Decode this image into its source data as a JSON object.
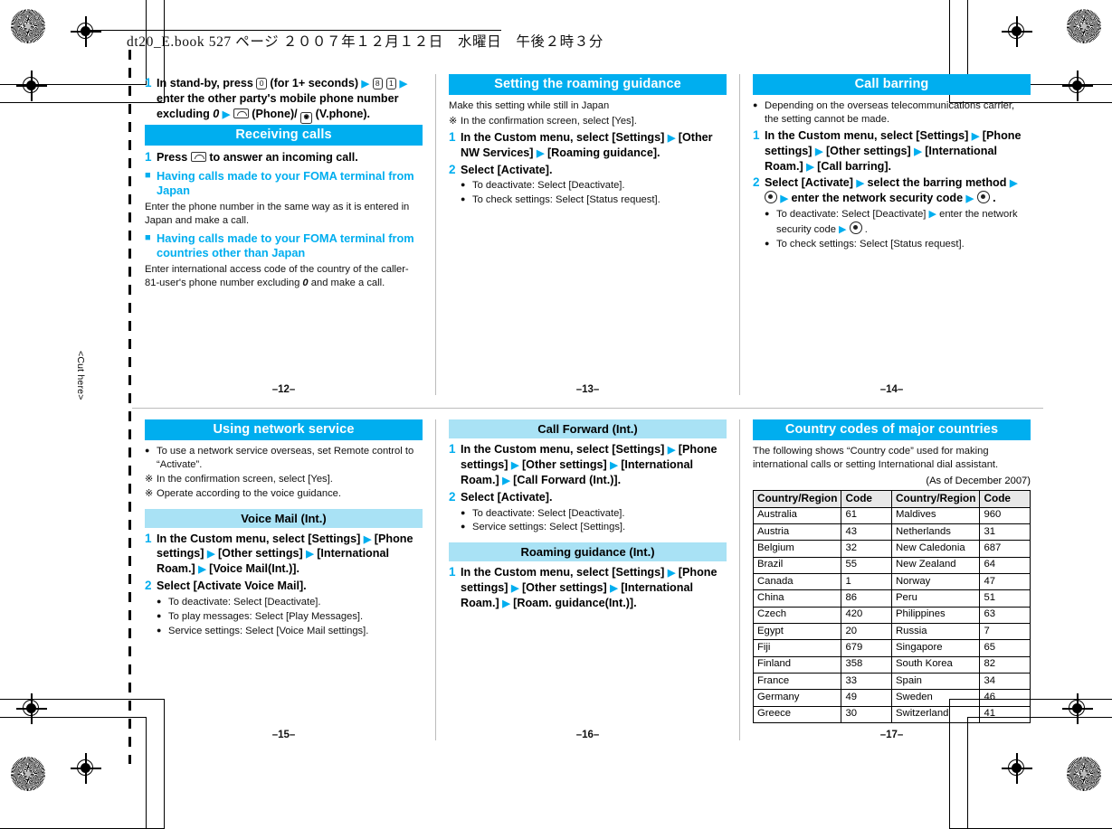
{
  "book_header": "dt20_E.book   527 ページ   ２００７年１２月１２日　水曜日　午後２時３分",
  "cut_here_label": "<Cut here>",
  "colors": {
    "accent": "#00aeef",
    "subhead": "#a9e2f5",
    "table_header": "#e8e8e8"
  },
  "pages": [
    {
      "page_number": "–12–",
      "blocks": [
        {
          "type": "step",
          "num": "1",
          "parts": [
            {
              "t": "text",
              "v": "In stand-by, press "
            },
            {
              "t": "key",
              "v": "0"
            },
            {
              "t": "text",
              "v": " (for 1+ seconds)"
            },
            {
              "t": "arrow"
            },
            {
              "t": "key",
              "v": "8"
            },
            {
              "t": "key",
              "v": "1"
            },
            {
              "t": "arrow"
            },
            {
              "t": "text",
              "v": " enter the other party's mobile phone number excluding "
            },
            {
              "t": "ital",
              "v": "0"
            },
            {
              "t": "arrow"
            },
            {
              "t": "key-call"
            },
            {
              "t": "text",
              "v": " (Phone)/"
            },
            {
              "t": "key-vph"
            },
            {
              "t": "text",
              "v": " (V.phone)."
            }
          ]
        },
        {
          "type": "sec-head",
          "v": "Receiving calls"
        },
        {
          "type": "step",
          "num": "1",
          "parts": [
            {
              "t": "text",
              "v": "Press "
            },
            {
              "t": "key-call"
            },
            {
              "t": "text",
              "v": " to answer an incoming call."
            }
          ]
        },
        {
          "type": "blue-head",
          "v": "Having calls made to your FOMA terminal from Japan"
        },
        {
          "type": "plain",
          "v": "Enter the phone number in the same way as it is entered in Japan and make a call."
        },
        {
          "type": "blue-head",
          "v": "Having calls made to your FOMA terminal from countries other than Japan"
        },
        {
          "type": "plain-ital0",
          "pre": "Enter international access code of the country of the caller-81-user's phone number excluding ",
          "ital": "0",
          "post": " and make a call."
        }
      ]
    },
    {
      "page_number": "–13–",
      "blocks": [
        {
          "type": "sec-head",
          "v": "Setting the roaming guidance"
        },
        {
          "type": "plain",
          "v": "Make this setting while still in Japan"
        },
        {
          "type": "note",
          "mark": "※",
          "v": "In the confirmation screen, select [Yes]."
        },
        {
          "type": "step",
          "num": "1",
          "parts": [
            {
              "t": "text",
              "v": "In the Custom menu, select [Settings]"
            },
            {
              "t": "arrow"
            },
            {
              "t": "text",
              "v": " [Other NW Services]"
            },
            {
              "t": "arrow"
            },
            {
              "t": "text",
              "v": " [Roaming guidance]."
            }
          ]
        },
        {
          "type": "step",
          "num": "2",
          "parts": [
            {
              "t": "text",
              "v": "Select [Activate]."
            }
          ]
        },
        {
          "type": "bullets",
          "items": [
            "To deactivate: Select [Deactivate].",
            "To check settings: Select [Status request]."
          ]
        }
      ]
    },
    {
      "page_number": "–14–",
      "blocks": [
        {
          "type": "sec-head",
          "v": "Call barring"
        },
        {
          "type": "note",
          "mark": "●",
          "v": "Depending on the overseas telecommunications carrier, the setting cannot be made."
        },
        {
          "type": "step",
          "num": "1",
          "parts": [
            {
              "t": "text",
              "v": "In the Custom menu, select [Settings]"
            },
            {
              "t": "arrow"
            },
            {
              "t": "text",
              "v": " [Phone settings]"
            },
            {
              "t": "arrow"
            },
            {
              "t": "text",
              "v": " [Other settings]"
            },
            {
              "t": "arrow"
            },
            {
              "t": "text",
              "v": " [International Roam.]"
            },
            {
              "t": "arrow"
            },
            {
              "t": "text",
              "v": " [Call barring]."
            }
          ]
        },
        {
          "type": "step",
          "num": "2",
          "parts": [
            {
              "t": "text",
              "v": "Select [Activate]"
            },
            {
              "t": "arrow"
            },
            {
              "t": "text",
              "v": " select the barring method"
            },
            {
              "t": "arrow"
            },
            {
              "t": "key-sel"
            },
            {
              "t": "arrow"
            },
            {
              "t": "text",
              "v": " enter the network security code"
            },
            {
              "t": "arrow"
            },
            {
              "t": "key-sel"
            },
            {
              "t": "text",
              "v": "."
            }
          ]
        },
        {
          "type": "bullets-rich",
          "items": [
            [
              {
                "t": "text",
                "v": "To deactivate: Select [Deactivate]"
              },
              {
                "t": "arrow"
              },
              {
                "t": "text",
                "v": " enter the network security code"
              },
              {
                "t": "arrow"
              },
              {
                "t": "key-sel"
              },
              {
                "t": "text",
                "v": "."
              }
            ],
            [
              {
                "t": "text",
                "v": "To check settings: Select [Status request]."
              }
            ]
          ]
        }
      ]
    },
    {
      "page_number": "–15–",
      "blocks": [
        {
          "type": "sec-head",
          "v": "Using network service"
        },
        {
          "type": "note",
          "mark": "●",
          "v": "To use a network service overseas, set Remote control to “Activate”."
        },
        {
          "type": "note",
          "mark": "※",
          "v": "In the confirmation screen, select [Yes]."
        },
        {
          "type": "note",
          "mark": "※",
          "v": "Operate according to the voice guidance."
        },
        {
          "type": "sub-head",
          "v": "Voice Mail (Int.)"
        },
        {
          "type": "step",
          "num": "1",
          "parts": [
            {
              "t": "text",
              "v": "In the Custom menu, select [Settings]"
            },
            {
              "t": "arrow"
            },
            {
              "t": "text",
              "v": " [Phone settings]"
            },
            {
              "t": "arrow"
            },
            {
              "t": "text",
              "v": " [Other settings]"
            },
            {
              "t": "arrow"
            },
            {
              "t": "text",
              "v": " [International Roam.]"
            },
            {
              "t": "arrow"
            },
            {
              "t": "text",
              "v": " [Voice Mail(Int.)]."
            }
          ]
        },
        {
          "type": "step",
          "num": "2",
          "parts": [
            {
              "t": "text",
              "v": "Select [Activate Voice Mail]."
            }
          ]
        },
        {
          "type": "bullets",
          "items": [
            "To deactivate: Select [Deactivate].",
            "To play messages: Select [Play Messages].",
            "Service settings: Select [Voice Mail settings]."
          ]
        }
      ]
    },
    {
      "page_number": "–16–",
      "blocks": [
        {
          "type": "sub-head-first",
          "v": "Call Forward (Int.)"
        },
        {
          "type": "step",
          "num": "1",
          "parts": [
            {
              "t": "text",
              "v": "In the Custom menu, select [Settings]"
            },
            {
              "t": "arrow"
            },
            {
              "t": "text",
              "v": " [Phone settings]"
            },
            {
              "t": "arrow"
            },
            {
              "t": "text",
              "v": " [Other settings]"
            },
            {
              "t": "arrow"
            },
            {
              "t": "text",
              "v": " [International Roam.]"
            },
            {
              "t": "arrow"
            },
            {
              "t": "text",
              "v": " [Call Forward (Int.)]."
            }
          ]
        },
        {
          "type": "step",
          "num": "2",
          "parts": [
            {
              "t": "text",
              "v": "Select [Activate]."
            }
          ]
        },
        {
          "type": "bullets",
          "items": [
            "To deactivate: Select [Deactivate].",
            "Service settings: Select [Settings]."
          ]
        },
        {
          "type": "sub-head",
          "v": "Roaming guidance (Int.)"
        },
        {
          "type": "step",
          "num": "1",
          "parts": [
            {
              "t": "text",
              "v": "In the Custom menu, select [Settings]"
            },
            {
              "t": "arrow"
            },
            {
              "t": "text",
              "v": " [Phone settings]"
            },
            {
              "t": "arrow"
            },
            {
              "t": "text",
              "v": " [Other settings]"
            },
            {
              "t": "arrow"
            },
            {
              "t": "text",
              "v": " [International Roam.]"
            },
            {
              "t": "arrow"
            },
            {
              "t": "text",
              "v": " [Roam. guidance(Int.)]."
            }
          ]
        }
      ]
    },
    {
      "page_number": "–17–",
      "blocks": [
        {
          "type": "sec-head",
          "v": "Country codes of major countries"
        },
        {
          "type": "plain",
          "v": "The following shows “Country code” used for making international calls or setting International dial assistant."
        },
        {
          "type": "asof",
          "v": "(As of December 2007)"
        },
        {
          "type": "country-table"
        }
      ]
    }
  ],
  "country_table": {
    "headers": [
      "Country/Region",
      "Code",
      "Country/Region",
      "Code"
    ],
    "rows": [
      [
        "Australia",
        "61",
        "Maldives",
        "960"
      ],
      [
        "Austria",
        "43",
        "Netherlands",
        "31"
      ],
      [
        "Belgium",
        "32",
        "New Caledonia",
        "687"
      ],
      [
        "Brazil",
        "55",
        "New Zealand",
        "64"
      ],
      [
        "Canada",
        "1",
        "Norway",
        "47"
      ],
      [
        "China",
        "86",
        "Peru",
        "51"
      ],
      [
        "Czech",
        "420",
        "Philippines",
        "63"
      ],
      [
        "Egypt",
        "20",
        "Russia",
        "7"
      ],
      [
        "Fiji",
        "679",
        "Singapore",
        "65"
      ],
      [
        "Finland",
        "358",
        "South Korea",
        "82"
      ],
      [
        "France",
        "33",
        "Spain",
        "34"
      ],
      [
        "Germany",
        "49",
        "Sweden",
        "46"
      ],
      [
        "Greece",
        "30",
        "Switzerland",
        "41"
      ]
    ]
  }
}
